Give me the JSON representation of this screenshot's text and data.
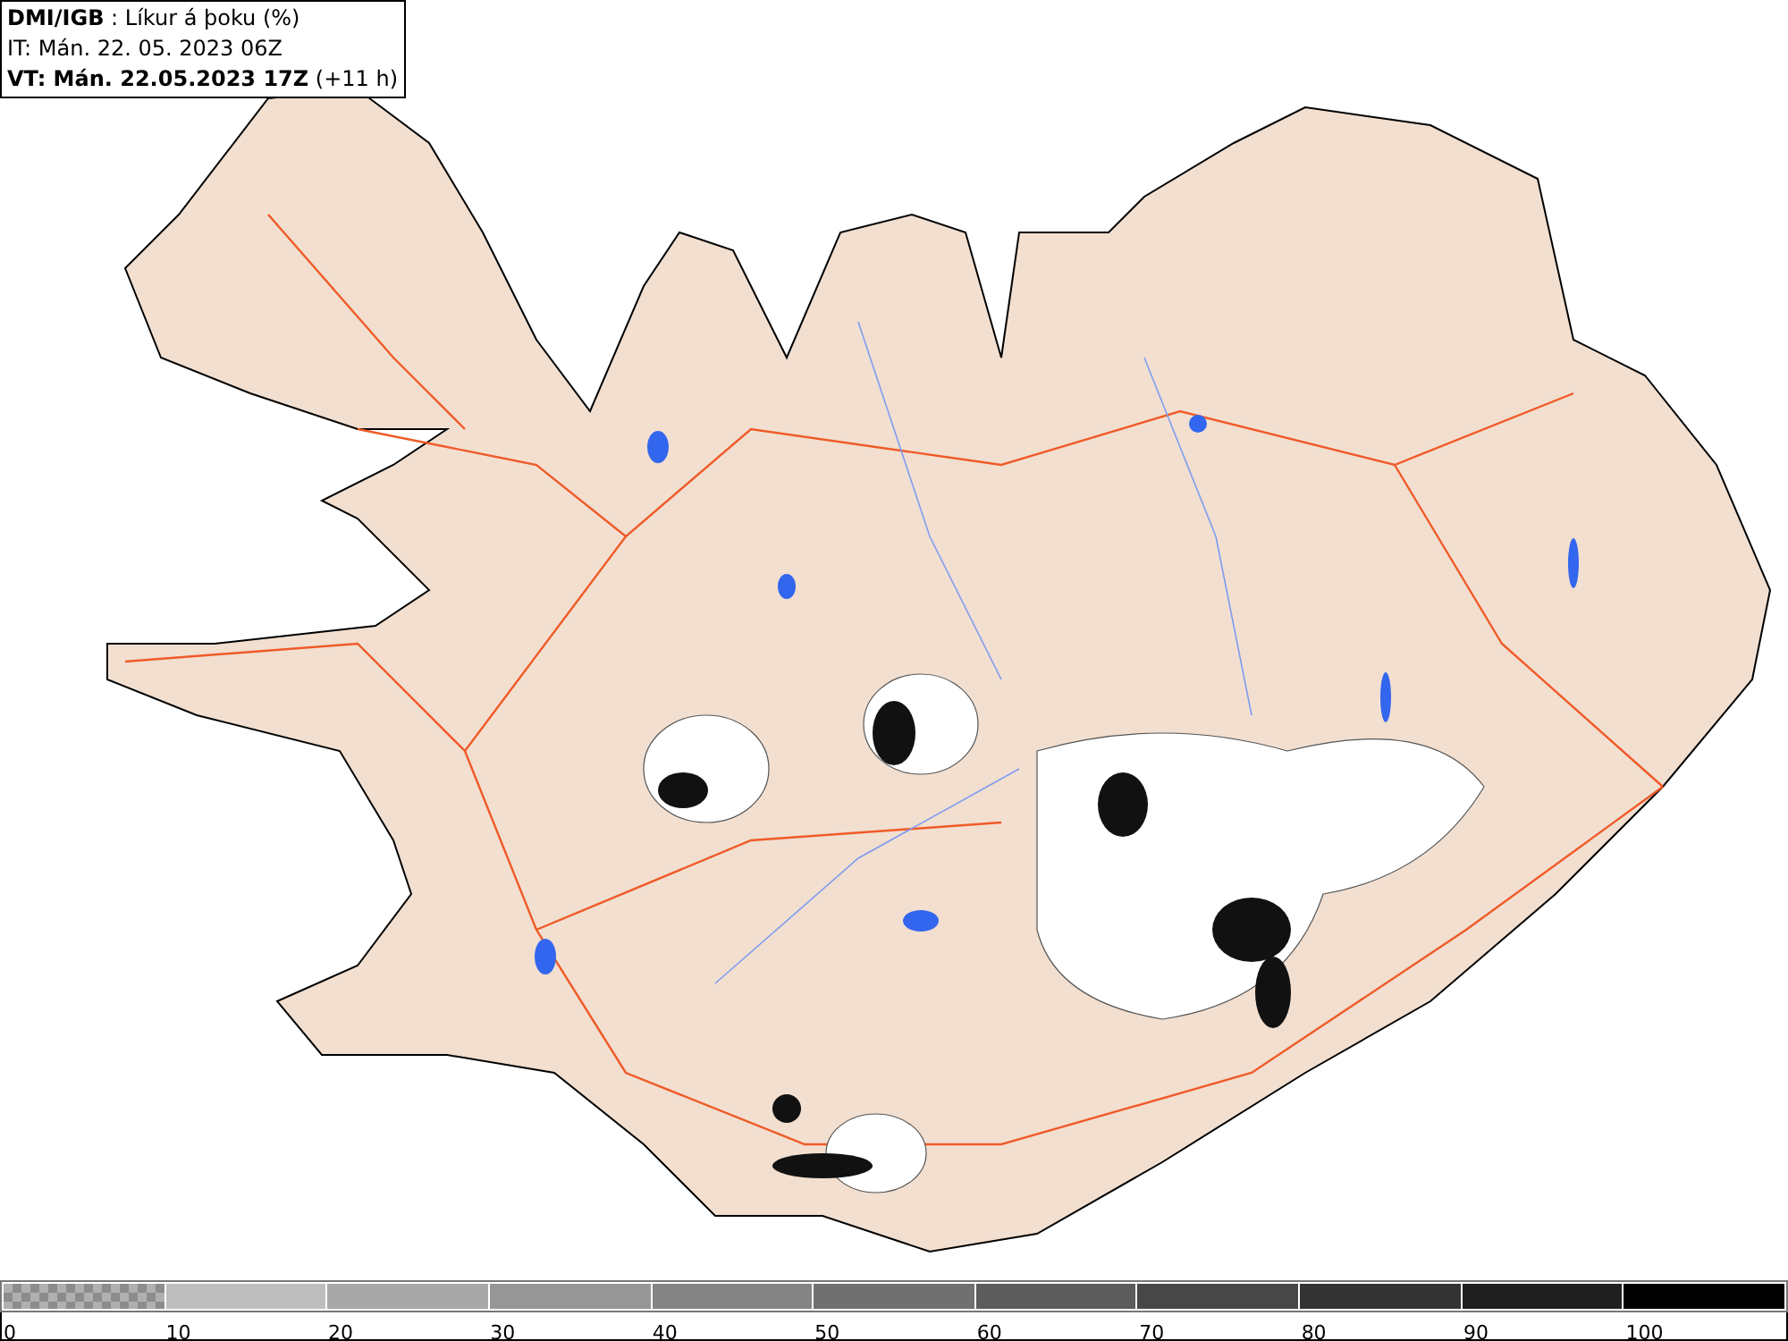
{
  "legend": {
    "title": "**DMI/IGB** : Líkur á þoku (%)",
    "issue_time": "IT: Mán. 22. 05. 2023 06Z",
    "valid_time": "**VT: Mán. 22.05.2023 17Z** (+11 h)"
  },
  "colorbar": [
    {
      "label": "0",
      "kind": "checker",
      "color": "#8c8c8c"
    },
    {
      "label": "10",
      "kind": "solid",
      "color": "#bdbdbd"
    },
    {
      "label": "20",
      "kind": "solid",
      "color": "#a8a8a8"
    },
    {
      "label": "30",
      "kind": "solid",
      "color": "#969696"
    },
    {
      "label": "40",
      "kind": "solid",
      "color": "#848484"
    },
    {
      "label": "50",
      "kind": "solid",
      "color": "#707070"
    },
    {
      "label": "60",
      "kind": "solid",
      "color": "#5c5c5c"
    },
    {
      "label": "70",
      "kind": "solid",
      "color": "#474747"
    },
    {
      "label": "80",
      "kind": "solid",
      "color": "#333333"
    },
    {
      "label": "90",
      "kind": "solid",
      "color": "#1f1f1f"
    },
    {
      "label": "100",
      "kind": "solid",
      "color": "#000000"
    }
  ]
}
